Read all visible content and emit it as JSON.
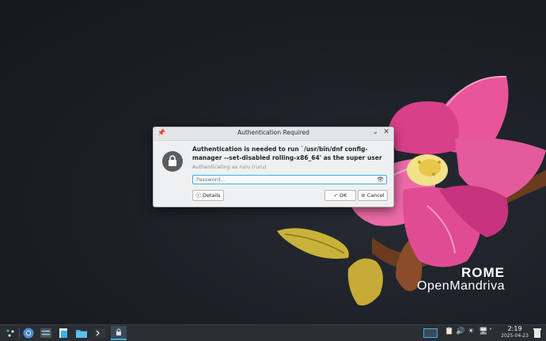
{
  "dialog": {
    "title": "Authentication Required",
    "message": "Authentication is needed to run `/usr/bin/dnf config-manager --set-disabled rolling-x86_64' as the super user",
    "subtitle": "Authenticating as ruru (ruru)",
    "password_placeholder": "Password...",
    "details_label": "Details",
    "ok_label": "OK",
    "cancel_label": "Cancel"
  },
  "branding": {
    "line1": "ROME",
    "line2": "OpenMandriva"
  },
  "taskbar": {
    "time": "2:19",
    "date": "2025-04-23",
    "launchers": [
      "app-launcher-icon",
      "chromium-icon",
      "system-settings-icon",
      "file-manager-icon",
      "dolphin-icon",
      "konsole-icon",
      "auth-dialog-task-icon"
    ]
  },
  "colors": {
    "accent": "#3daee9",
    "panel": "#2a2e32",
    "dialog_bg": "#eff0f1"
  }
}
